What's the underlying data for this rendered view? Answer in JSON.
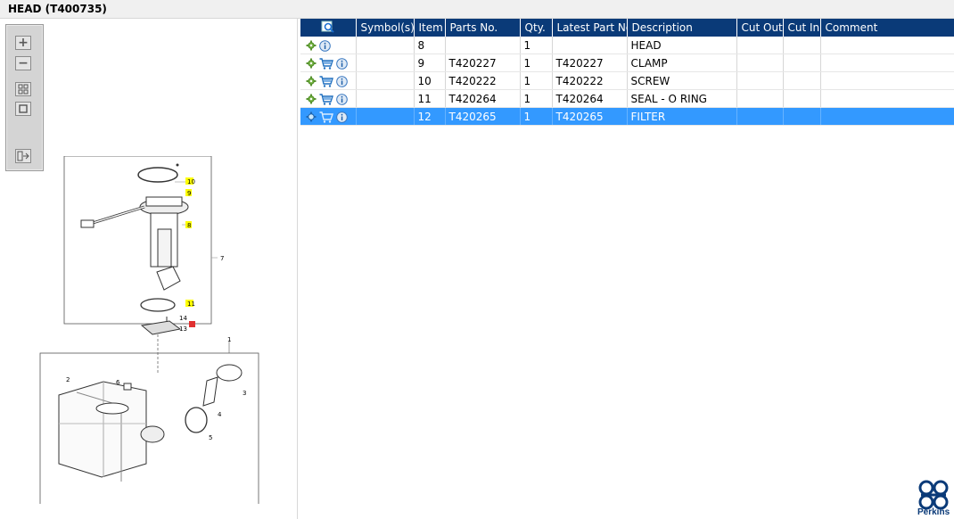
{
  "title": "HEAD (T400735)",
  "toolbar": {
    "zoom_in": "zoom-in-icon",
    "zoom_out": "zoom-out-icon",
    "fit_all": "fit-all-icon",
    "fit_window": "fit-window-icon",
    "export": "export-icon"
  },
  "diagram": {
    "callouts_highlighted": [
      "10",
      "9",
      "8",
      "11"
    ],
    "callouts_plain": [
      "7",
      "14",
      "13",
      "1",
      "2",
      "6",
      "3",
      "4",
      "5"
    ]
  },
  "table": {
    "headers": [
      "",
      "Symbol(s)",
      "Item",
      "Parts No.",
      "Qty.",
      "Latest Part No.",
      "Description",
      "Cut Out",
      "Cut In",
      "Comment"
    ],
    "rows": [
      {
        "item": "8",
        "parts_no": "",
        "qty": "1",
        "latest": "",
        "desc": "HEAD",
        "cart": false,
        "selected": false
      },
      {
        "item": "9",
        "parts_no": "T420227",
        "qty": "1",
        "latest": "T420227",
        "desc": "CLAMP",
        "cart": true,
        "selected": false
      },
      {
        "item": "10",
        "parts_no": "T420222",
        "qty": "1",
        "latest": "T420222",
        "desc": "SCREW",
        "cart": true,
        "selected": false
      },
      {
        "item": "11",
        "parts_no": "T420264",
        "qty": "1",
        "latest": "T420264",
        "desc": "SEAL - O RING",
        "cart": true,
        "selected": false
      },
      {
        "item": "12",
        "parts_no": "T420265",
        "qty": "1",
        "latest": "T420265",
        "desc": "FILTER",
        "cart": true,
        "selected": true
      }
    ]
  },
  "brand": {
    "name": "Perkins",
    "color": "#0a3a78"
  },
  "colors": {
    "header_bg": "#0a3a78",
    "selection_bg": "#3399ff",
    "callout_highlight": "#ffff00"
  }
}
